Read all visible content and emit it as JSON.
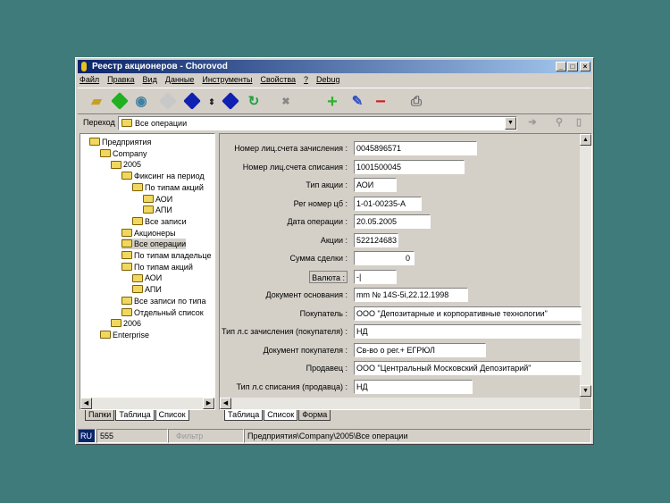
{
  "window": {
    "title": "Реестр акционеров - Chorovod",
    "minimize": "_",
    "maximize": "□",
    "close": "×"
  },
  "menu": [
    "Файл",
    "Правка",
    "Вид",
    "Данные",
    "Инструменты",
    "Свойства",
    "?",
    "Debug"
  ],
  "toolbar": {
    "icons": [
      "open-folder-icon",
      "back-icon",
      "refresh-globe-icon",
      "forward-icon",
      "up-icon",
      "updown-icon",
      "down-icon",
      "reload-doc-icon",
      "delete-doc-icon",
      "add-icon",
      "edit-icon",
      "remove-icon",
      "print-icon"
    ]
  },
  "address": {
    "label": "Переход",
    "value": "Все операции"
  },
  "tree": [
    {
      "label": "Предприятия",
      "level": 0
    },
    {
      "label": "Company",
      "level": 1
    },
    {
      "label": "2005",
      "level": 2
    },
    {
      "label": "Фиксинг на период",
      "level": 3
    },
    {
      "label": "По типам акций",
      "level": 4
    },
    {
      "label": "АОИ",
      "level": 5
    },
    {
      "label": "АПИ",
      "level": 5
    },
    {
      "label": "Все записи",
      "level": 4
    },
    {
      "label": "Акционеры",
      "level": 3
    },
    {
      "label": "Все операции",
      "level": 3,
      "selected": true
    },
    {
      "label": "По типам владельце",
      "level": 3
    },
    {
      "label": "По типам акций",
      "level": 3
    },
    {
      "label": "АОИ",
      "level": 4
    },
    {
      "label": "АПИ",
      "level": 4
    },
    {
      "label": "Все записи по типа",
      "level": 3
    },
    {
      "label": "Отдельный список",
      "level": 3
    },
    {
      "label": "2006",
      "level": 2
    },
    {
      "label": "Enterprise",
      "level": 1
    }
  ],
  "form": [
    {
      "label": "Номер лиц.счета зачисления :",
      "value": "0045896571"
    },
    {
      "label": "Номер лиц.счета списания :",
      "value": "1001500045"
    },
    {
      "label": "Тип акции :",
      "value": "АОИ"
    },
    {
      "label": "Рег номер цб :",
      "value": "1-01-00235-А"
    },
    {
      "label": "Дата операции :",
      "value": "20.05.2005"
    },
    {
      "label": "Акции :",
      "value": "522124683"
    },
    {
      "label": "Сумма сделки :",
      "value": "0"
    },
    {
      "label": "Валюта :",
      "value": "-|"
    },
    {
      "label": "Документ основания :",
      "value": "mm № 14S-5i,22.12.1998"
    },
    {
      "label": "Покупатель :",
      "value": "ООО \"Депозитарные и корпоративные технологии\""
    },
    {
      "label": "Тип л.с зачисления (покупателя) :",
      "value": "НД"
    },
    {
      "label": "Документ покупателя :",
      "value": "Св-во о рег.+ ЕГРЮЛ"
    },
    {
      "label": "Продавец :",
      "value": "ООО \"Центральный Московский Депозитарий\""
    },
    {
      "label": "Тип л.с списания (продавца) :",
      "value": "НД"
    }
  ],
  "left_tabs": [
    "Папки",
    "Таблица",
    "Список"
  ],
  "right_tabs": [
    "Таблица",
    "Список",
    "Форма"
  ],
  "status": {
    "lang": "RU",
    "count": "555",
    "filter": "Фильтр",
    "path": "Предприятия\\Company\\2005\\Все операции"
  }
}
